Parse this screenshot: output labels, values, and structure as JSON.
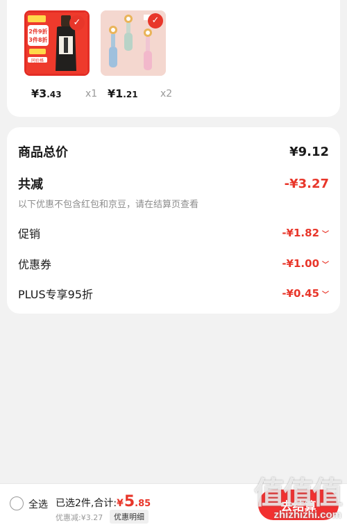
{
  "products": [
    {
      "price_symbol": "¥",
      "price_int": "3",
      "price_dec": ".43",
      "qty": "x1",
      "badge_line1": "2件9折",
      "badge_line2": "3件8折",
      "badge_tag": "同价格",
      "selected": true
    },
    {
      "price_symbol": "¥",
      "price_int": "1",
      "price_dec": ".21",
      "qty": "x2",
      "selected": true
    }
  ],
  "summary": {
    "total_label": "商品总价",
    "total_value": "¥9.12",
    "reduce_label": "共减",
    "reduce_value": "-¥3.27",
    "note": "以下优惠不包含红包和京豆，请在结算页查看",
    "rows": [
      {
        "label": "促销",
        "value": "-¥1.82"
      },
      {
        "label": "优惠券",
        "value": "-¥1.00"
      },
      {
        "label": "PLUS专享95折",
        "value": "-¥0.45"
      }
    ]
  },
  "bottom": {
    "select_all": "全选",
    "selected_text": "已选2件,合计:",
    "total_symbol": "¥",
    "total_int": "5",
    "total_dec": ".85",
    "discount": "优惠减:¥3.27",
    "detail_btn": "优惠明细",
    "checkout_btn": "去结算"
  },
  "watermark": {
    "big": "值值值",
    "small": "zhizhizhi.com"
  },
  "colors": {
    "accent": "#e8362a",
    "checkout": "#f23030"
  }
}
